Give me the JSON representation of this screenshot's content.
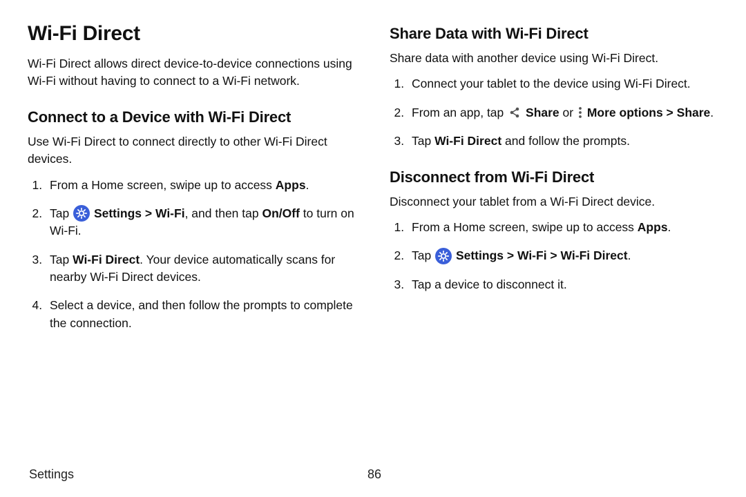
{
  "left": {
    "h1": "Wi-Fi Direct",
    "intro": "Wi-Fi Direct allows direct device-to-device connections using Wi-Fi without having to connect to a Wi-Fi network.",
    "connect": {
      "heading": "Connect to a Device with Wi-Fi Direct",
      "intro": "Use Wi-Fi Direct to connect directly to other Wi-Fi Direct devices.",
      "step1_a": "From a Home screen, swipe up to access ",
      "step1_b": "Apps",
      "step1_c": ".",
      "step2_a": "Tap ",
      "step2_b": "Settings",
      "step2_c": " > ",
      "step2_d": "Wi-Fi",
      "step2_e": ", and then tap ",
      "step2_f": "On/Off",
      "step2_g": " to turn on Wi-Fi.",
      "step3_a": "Tap ",
      "step3_b": "Wi-Fi Direct",
      "step3_c": ". Your device automatically scans for nearby Wi-Fi Direct devices.",
      "step4": "Select a device, and then follow the prompts to complete the connection."
    }
  },
  "right": {
    "share": {
      "heading": "Share Data with Wi-Fi Direct",
      "intro": "Share data with another device using Wi-Fi Direct.",
      "step1": "Connect your tablet to the device using Wi-Fi Direct.",
      "step2_a": "From an app, tap ",
      "step2_b": "Share",
      "step2_c": " or ",
      "step2_d": "More options",
      "step2_e": " > ",
      "step2_f": "Share",
      "step2_g": ".",
      "step3_a": "Tap ",
      "step3_b": "Wi-Fi Direct",
      "step3_c": " and follow the prompts."
    },
    "disconnect": {
      "heading": "Disconnect from Wi-Fi Direct",
      "intro": "Disconnect your tablet from a Wi-Fi Direct device.",
      "step1_a": "From a Home screen, swipe up to access ",
      "step1_b": "Apps",
      "step1_c": ".",
      "step2_a": "Tap ",
      "step2_b": "Settings",
      "step2_c": " > ",
      "step2_d": "Wi-Fi",
      "step2_e": " > ",
      "step2_f": "Wi-Fi Direct",
      "step2_g": ".",
      "step3": "Tap a device to disconnect it."
    }
  },
  "footer": {
    "section": "Settings",
    "page": "86"
  },
  "icons": {
    "settings": "settings-gear-blue",
    "share": "share-three-dots",
    "more": "more-vertical-dots"
  }
}
